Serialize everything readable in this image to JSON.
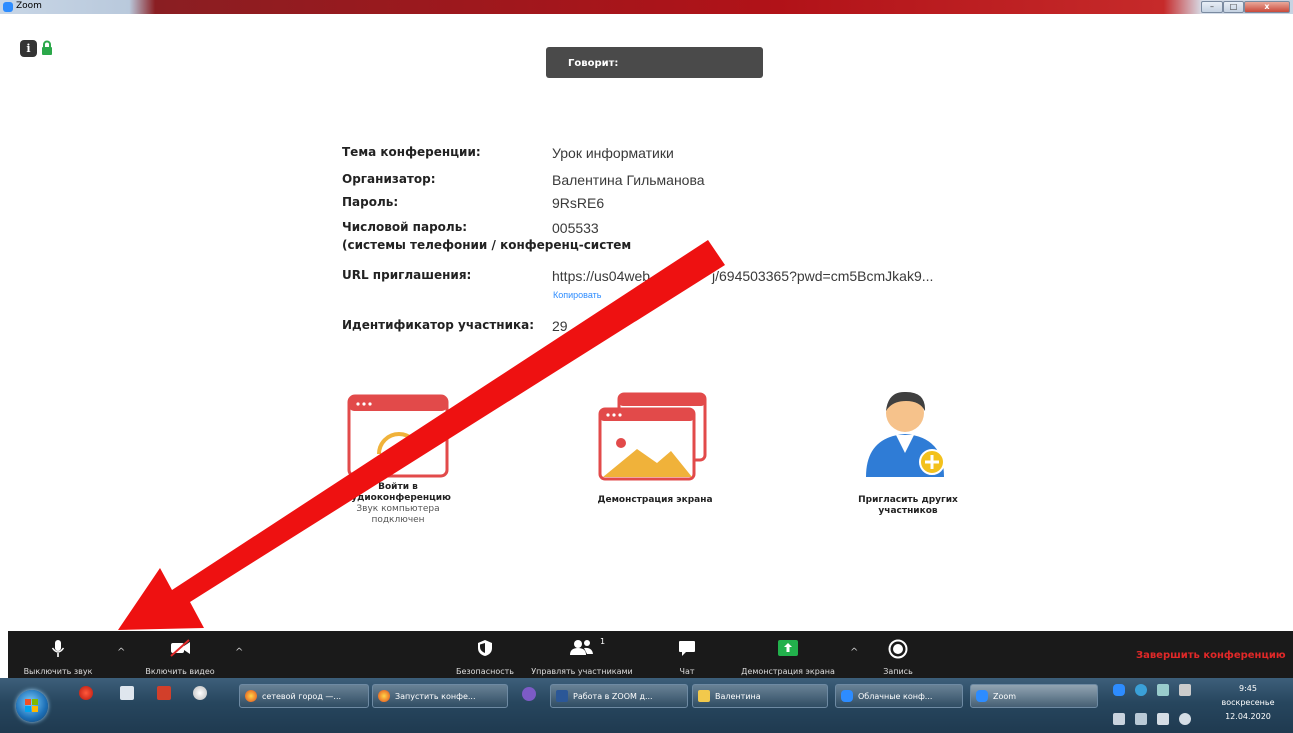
{
  "window": {
    "title": "Zoom",
    "minimize_glyph": "–",
    "maximize_glyph": "□",
    "close_glyph": "x"
  },
  "top": {
    "info_glyph": "i",
    "speaking_label": "Говорит:"
  },
  "meeting_info": {
    "topic_label": "Тема конференции:",
    "topic_value": "Урок информатики",
    "host_label": "Организатор:",
    "host_value": "Валентина Гильманова",
    "password_label": "Пароль:",
    "password_value": "9RsRE6",
    "numeric_password_label": "Числовой пароль:",
    "numeric_password_label2": "(системы телефонии / конференц-систем",
    "numeric_password_value": "005533",
    "url_label": "URL приглашения:",
    "url_value": "https://us04web",
    "url_value_tail": "j/694503365?pwd=cm5BcmJkak9...",
    "copy_link": "Копировать",
    "participant_id_label": "Идентификатор участника:",
    "participant_id_value": "29"
  },
  "tiles": {
    "audio_title": "Войти в аудиоконференцию",
    "audio_title_line1": "Войти в",
    "audio_title_line2": "аудиоконференцию",
    "audio_sub_line1": "Звук компьютера",
    "audio_sub_line2": "подключен",
    "share_title": "Демонстрация экрана",
    "invite_line1": "Пригласить других",
    "invite_line2": "участников"
  },
  "toolbar": {
    "mute": "Выключить звук",
    "video": "Включить видео",
    "security": "Безопасность",
    "participants": "Управлять участниками",
    "participants_count": "1",
    "chat": "Чат",
    "share": "Демонстрация экрана",
    "record": "Запись",
    "end": "Завершить конференцию",
    "caret": "^"
  },
  "taskbar": {
    "tasks": [
      {
        "label": "сетевой город —..."
      },
      {
        "label": "Запустить конфе..."
      },
      {
        "label": "Работа в ZOOM д..."
      },
      {
        "label": "Валентина"
      },
      {
        "label": "Облачные конф..."
      },
      {
        "label": "Zoom"
      }
    ],
    "clock_time": "9:45",
    "clock_day": "воскресенье",
    "clock_date": "12.04.2020"
  },
  "colors": {
    "toolbar_bg": "#1a1a1a",
    "end_red": "#e02828",
    "share_green": "#22b14c",
    "zoom_blue": "#2d8cff",
    "arrow_red": "#ee1111"
  },
  "icons": {
    "info": "info-icon",
    "lock": "lock-icon",
    "mic": "mic-icon",
    "video_off": "video-off-icon",
    "shield": "shield-icon",
    "participants": "participants-icon",
    "chat": "chat-bubble-icon",
    "share": "share-screen-icon",
    "record": "record-icon"
  }
}
